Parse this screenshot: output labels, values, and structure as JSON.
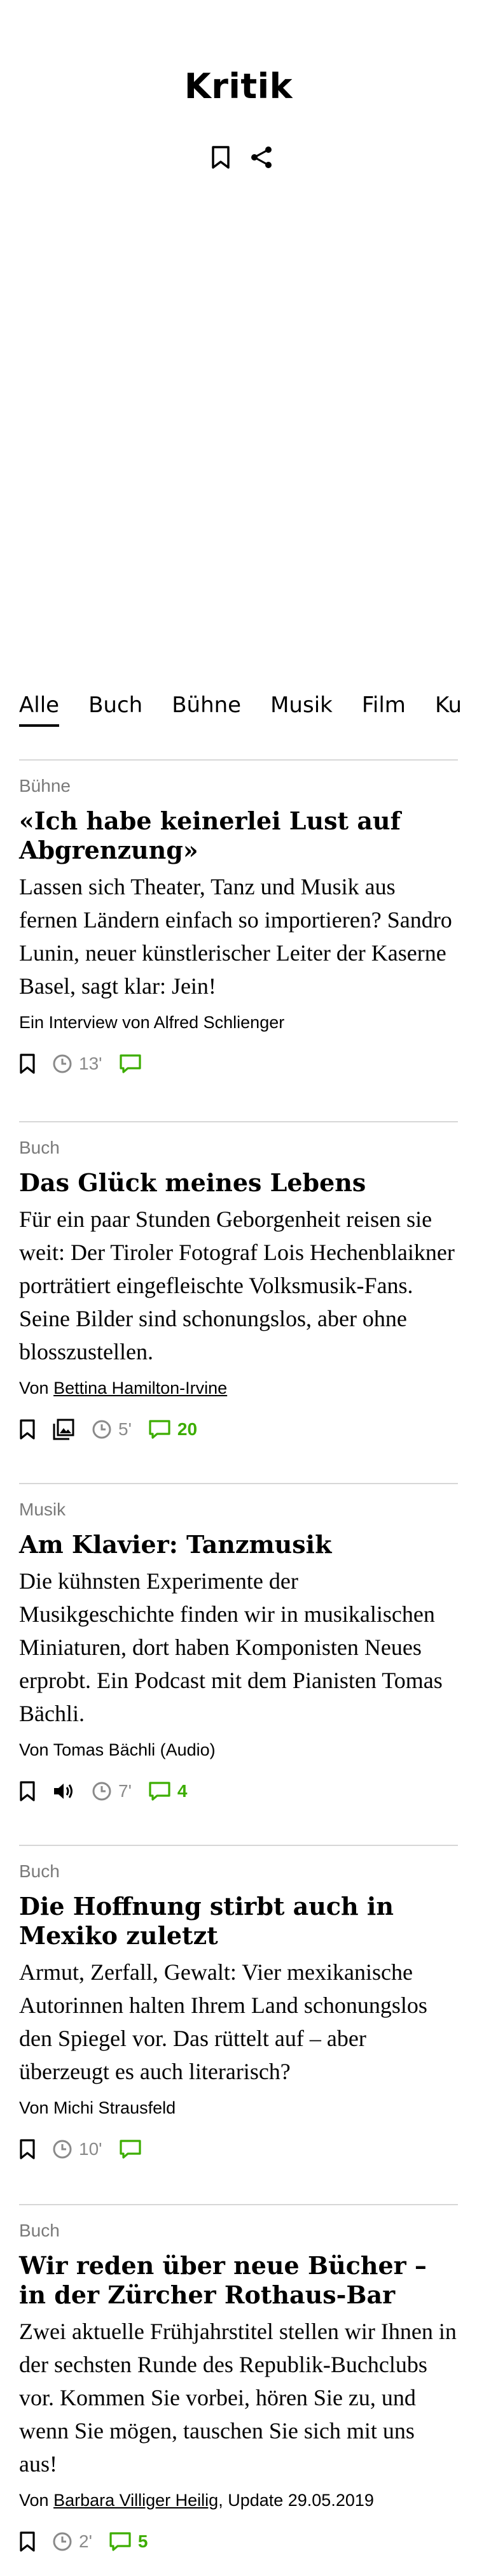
{
  "header": {
    "title": "Kritik",
    "bookmark_icon": "bookmark-icon",
    "share_icon": "share-icon"
  },
  "tabs": [
    {
      "label": "Alle",
      "active": true
    },
    {
      "label": "Buch",
      "active": false
    },
    {
      "label": "Bühne",
      "active": false
    },
    {
      "label": "Musik",
      "active": false
    },
    {
      "label": "Film",
      "active": false
    },
    {
      "label": "Ku",
      "active": false
    }
  ],
  "colors": {
    "accent_green": "#3cad00",
    "meta_gray": "#7a7a7a",
    "divider": "#d7d7d7"
  },
  "articles": [
    {
      "format": "Bühne",
      "title": "«Ich habe keinerlei Lust auf Abgrenzung»",
      "lead": "Lassen sich Theater, Tanz und Musik aus fernen Ländern einfach so importieren? Sandro Lunin, neuer künstlerischer Leiter der Kaserne Basel, sagt klar: Jein!",
      "credit_prefix": "Ein Interview von Alfred Schlienger",
      "credit_author": "",
      "credit_suffix": "",
      "minutes": "13'",
      "comments": ""
    },
    {
      "format": "Buch",
      "title": "Das Glück meines Lebens",
      "lead": "Für ein paar Stunden Geborgenheit reisen sie weit: Der Tiroler Fotograf Lois Hechenblaikner porträtiert eingefleischte Volksmusik-Fans. Seine Bilder sind schonungslos, aber ohne blosszustellen.",
      "credit_prefix": "Von ",
      "credit_author": "Bettina Hamilton-Irvine",
      "credit_suffix": "",
      "minutes": "5'",
      "comments": "20"
    },
    {
      "format": "Musik",
      "title": "Am Klavier: Tanzmusik",
      "lead": "Die kühnsten Experimente der Musikgeschichte finden wir in musikalischen Miniaturen, dort haben Komponisten Neues erprobt. Ein Podcast mit dem Pianisten Tomas Bächli.",
      "credit_prefix": "Von Tomas Bächli (Audio)",
      "credit_author": "",
      "credit_suffix": "",
      "minutes": "7'",
      "comments": "4"
    },
    {
      "format": "Buch",
      "title": "Die Hoffnung stirbt auch in Mexiko zuletzt",
      "lead": "Armut, Zerfall, Gewalt: Vier mexikanische Autorinnen halten Ihrem Land schonungslos den Spiegel vor. Das rüttelt auf – aber überzeugt es auch literarisch?",
      "credit_prefix": "Von Michi Strausfeld",
      "credit_author": "",
      "credit_suffix": "",
      "minutes": "10'",
      "comments": ""
    },
    {
      "format": "Buch",
      "title": "Wir reden über neue Bücher – in der Zürcher Rothaus-Bar",
      "lead": "Zwei aktuelle Frühjahrstitel stellen wir Ihnen in der sechsten Runde des Republik-Buchclubs vor. Kommen Sie vorbei, hören Sie zu, und wenn Sie mögen, tauschen Sie sich mit uns aus!",
      "credit_prefix": "Von ",
      "credit_author": "Barbara Villiger Heilig",
      "credit_suffix": ", Update 29.05.2019",
      "minutes": "2'",
      "comments": "5"
    }
  ]
}
